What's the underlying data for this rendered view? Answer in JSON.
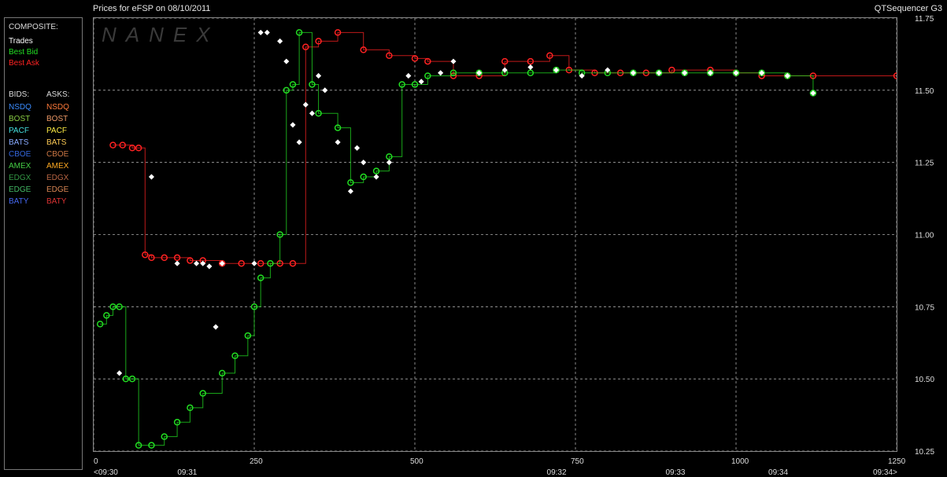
{
  "header": {
    "title": "Prices for  eFSP  on  08/10/2011",
    "app_name": "QTSequencer G3"
  },
  "legend": {
    "composite_label": "COMPOSITE:",
    "composite_items": [
      {
        "label": "Trades",
        "color": "#ffffff"
      },
      {
        "label": "Best Bid",
        "color": "#22dd22"
      },
      {
        "label": "Best Ask",
        "color": "#ff2222"
      }
    ],
    "bids_label": "BIDS:",
    "asks_label": "ASKS:",
    "exchanges": [
      {
        "bid": "NSDQ",
        "bid_color": "#3a8cff",
        "ask": "NSDQ",
        "ask_color": "#ff7a3a"
      },
      {
        "bid": "BOST",
        "bid_color": "#88cc44",
        "ask": "BOST",
        "ask_color": "#ee9966"
      },
      {
        "bid": "PACF",
        "bid_color": "#44e0e0",
        "ask": "PACF",
        "ask_color": "#ffee44"
      },
      {
        "bid": "BATS",
        "bid_color": "#88aaff",
        "ask": "BATS",
        "ask_color": "#ffcc55"
      },
      {
        "bid": "CBOE",
        "bid_color": "#3366dd",
        "ask": "CBOE",
        "ask_color": "#cc7744"
      },
      {
        "bid": "AMEX",
        "bid_color": "#44cc44",
        "ask": "AMEX",
        "ask_color": "#ffaa22"
      },
      {
        "bid": "EDGX",
        "bid_color": "#339944",
        "ask": "EDGX",
        "ask_color": "#bb6644"
      },
      {
        "bid": "EDGE",
        "bid_color": "#44bb66",
        "ask": "EDGE",
        "ask_color": "#dd8855"
      },
      {
        "bid": "BATY",
        "bid_color": "#4466ee",
        "ask": "BATY",
        "ask_color": "#dd3333"
      }
    ]
  },
  "watermark": "NANEX",
  "chart_data": {
    "type": "line",
    "title": "Prices for  eFSP  on  08/10/2011",
    "xlim": [
      0,
      1250
    ],
    "ylim": [
      10.25,
      11.75
    ],
    "x_ticks": [
      "0",
      "250",
      "500",
      "750",
      "1000",
      "1250"
    ],
    "x_tick_values": [
      0,
      250,
      500,
      750,
      1000,
      1250
    ],
    "time_labels": [
      "<09:30",
      "09:31",
      "09:32",
      "09:33",
      "09:34",
      "09:34>"
    ],
    "time_label_values": [
      0,
      145,
      720,
      905,
      1065,
      1250
    ],
    "y_ticks": [
      "11.75",
      "11.50",
      "11.25",
      "11.00",
      "10.75",
      "10.50",
      "10.25"
    ],
    "y_tick_values": [
      11.75,
      11.5,
      11.25,
      11.0,
      10.75,
      10.5,
      10.25
    ],
    "grid": true,
    "series": [
      {
        "name": "Best Ask",
        "color": "#ff2222",
        "x": [
          30,
          45,
          60,
          70,
          80,
          90,
          110,
          130,
          150,
          170,
          200,
          230,
          260,
          290,
          310,
          330,
          350,
          380,
          420,
          460,
          500,
          520,
          560,
          600,
          640,
          680,
          710,
          740,
          780,
          820,
          860,
          900,
          960,
          1000,
          1040,
          1080,
          1120,
          1250
        ],
        "y": [
          11.31,
          11.31,
          11.3,
          11.3,
          10.93,
          10.92,
          10.92,
          10.92,
          10.91,
          10.91,
          10.9,
          10.9,
          10.9,
          10.9,
          10.9,
          11.65,
          11.67,
          11.7,
          11.64,
          11.62,
          11.61,
          11.6,
          11.55,
          11.55,
          11.6,
          11.6,
          11.62,
          11.57,
          11.56,
          11.56,
          11.56,
          11.57,
          11.57,
          11.56,
          11.55,
          11.55,
          11.55,
          11.55
        ]
      },
      {
        "name": "Best Bid",
        "color": "#22dd22",
        "x": [
          10,
          20,
          30,
          40,
          50,
          60,
          70,
          90,
          110,
          130,
          150,
          170,
          200,
          220,
          240,
          250,
          260,
          275,
          290,
          300,
          310,
          320,
          340,
          350,
          380,
          400,
          420,
          440,
          460,
          480,
          500,
          520,
          560,
          600,
          640,
          680,
          720,
          760,
          800,
          840,
          880,
          920,
          960,
          1000,
          1040,
          1080,
          1120
        ],
        "y": [
          10.69,
          10.72,
          10.75,
          10.75,
          10.5,
          10.5,
          10.27,
          10.27,
          10.3,
          10.35,
          10.4,
          10.45,
          10.52,
          10.58,
          10.65,
          10.75,
          10.85,
          10.9,
          11.0,
          11.5,
          11.52,
          11.7,
          11.52,
          11.42,
          11.37,
          11.18,
          11.2,
          11.22,
          11.27,
          11.52,
          11.52,
          11.55,
          11.56,
          11.56,
          11.56,
          11.56,
          11.57,
          11.56,
          11.56,
          11.56,
          11.56,
          11.56,
          11.56,
          11.56,
          11.56,
          11.55,
          11.49
        ]
      },
      {
        "name": "Trades",
        "color": "#ffffff",
        "x": [
          40,
          90,
          130,
          160,
          170,
          180,
          190,
          200,
          250,
          260,
          270,
          290,
          300,
          310,
          320,
          330,
          340,
          350,
          360,
          380,
          400,
          410,
          420,
          440,
          460,
          490,
          510,
          540,
          560,
          600,
          640,
          680,
          720,
          760,
          800,
          840,
          880,
          920,
          960,
          1000,
          1040,
          1080,
          1120
        ],
        "y": [
          10.52,
          11.2,
          10.9,
          10.9,
          10.9,
          10.89,
          10.68,
          10.9,
          10.9,
          11.7,
          11.7,
          11.67,
          11.6,
          11.38,
          11.32,
          11.45,
          11.42,
          11.55,
          11.5,
          11.32,
          11.15,
          11.3,
          11.25,
          11.2,
          11.25,
          11.55,
          11.53,
          11.56,
          11.6,
          11.56,
          11.57,
          11.58,
          11.57,
          11.55,
          11.57,
          11.56,
          11.56,
          11.56,
          11.56,
          11.56,
          11.56,
          11.55,
          11.49
        ]
      }
    ]
  }
}
